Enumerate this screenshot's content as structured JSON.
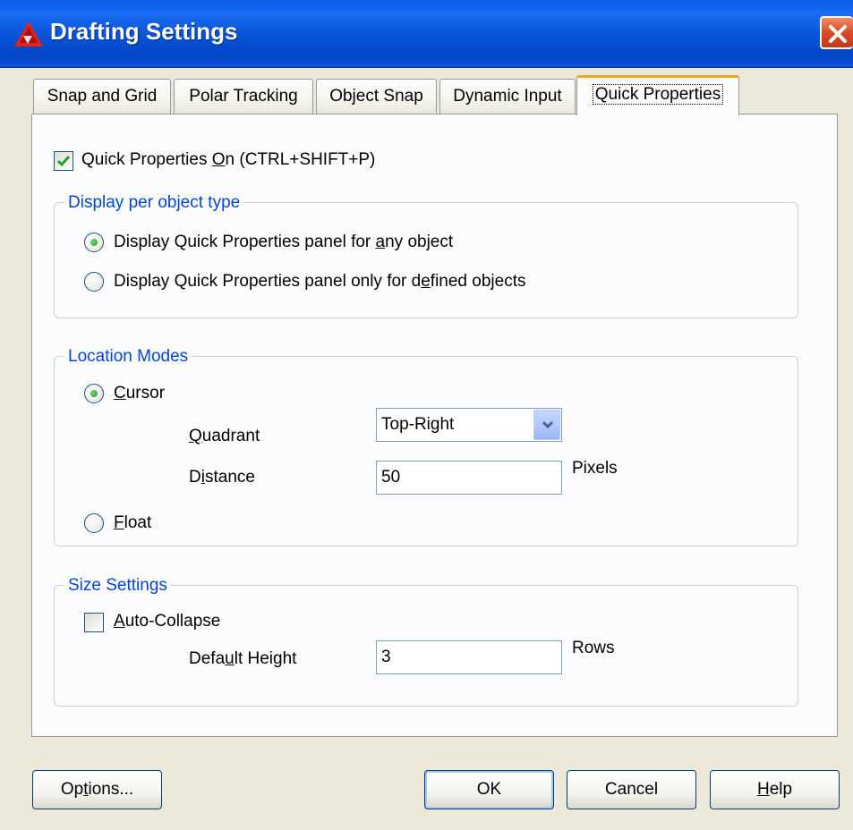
{
  "window": {
    "title": "Drafting Settings",
    "app_icon": "autocad-logo-icon",
    "close_icon": "close-icon"
  },
  "tabs": [
    {
      "label": "Snap and Grid",
      "active": false
    },
    {
      "label": "Polar Tracking",
      "active": false
    },
    {
      "label": "Object Snap",
      "active": false
    },
    {
      "label": "Dynamic Input",
      "active": false
    },
    {
      "label": "Quick Properties",
      "active": true
    }
  ],
  "quick_properties": {
    "enable": {
      "label_pre": "Quick Properties ",
      "accel": "O",
      "label_post": "n (CTRL+SHIFT+P)",
      "checked": true
    },
    "display_group": {
      "title": "Display per object type",
      "any": {
        "pre": "Display Quick Properties panel for ",
        "accel": "a",
        "post": "ny object",
        "selected": true
      },
      "defined": {
        "pre": "Display Quick Properties panel only for d",
        "accel": "e",
        "post": "fined objects",
        "selected": false
      }
    },
    "location_group": {
      "title": "Location Modes",
      "cursor": {
        "accel": "C",
        "post": "ursor",
        "selected": true
      },
      "quadrant": {
        "accel": "Q",
        "post": "uadrant",
        "value": "Top-Right"
      },
      "distance": {
        "pre": "D",
        "accel": "i",
        "post": "stance",
        "value": "50",
        "unit": "Pixels"
      },
      "float": {
        "accel": "F",
        "post": "loat",
        "selected": false
      }
    },
    "size_group": {
      "title": "Size Settings",
      "auto_collapse": {
        "accel": "A",
        "post": "uto-Collapse",
        "checked": false
      },
      "default_height": {
        "pre": "Defa",
        "accel": "u",
        "post": "lt Height",
        "value": "3",
        "unit": "Rows"
      }
    }
  },
  "buttons": {
    "options": {
      "pre": "Op",
      "accel": "t",
      "post": "ions..."
    },
    "ok": "OK",
    "cancel": "Cancel",
    "help": {
      "accel": "H",
      "post": "elp"
    }
  },
  "colors": {
    "title_bar": "#0a5ee8",
    "group_title": "#0046d5",
    "tab_highlight": "#f5a623",
    "check_green": "#21a121"
  }
}
